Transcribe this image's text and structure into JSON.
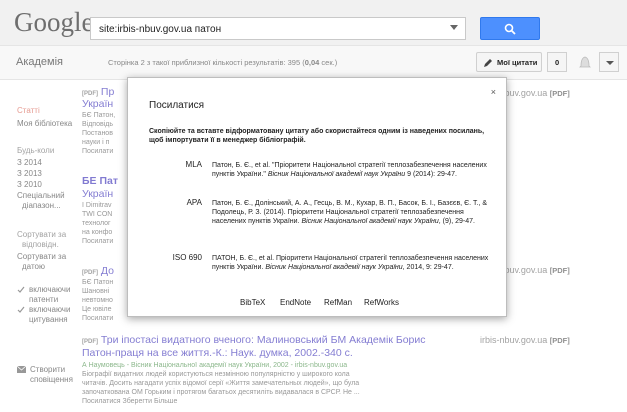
{
  "header": {
    "logo": "Google",
    "search_value": "site:irbis-nbuv.gov.ua патон",
    "search_icon": "search-icon"
  },
  "subheader": {
    "academy": "Академія",
    "result_stats_prefix": "Сторінка 2 з такої приблизної кількості результатів: 395 (",
    "result_stats_time": "0,04",
    "result_stats_suffix": " сек.)",
    "my_quotes": "Мої цитати",
    "count": "0"
  },
  "sidebar": {
    "items": [
      "Статті",
      "Моя бібліотека"
    ],
    "time_label": "Будь-коли",
    "years": [
      "З 2014",
      "З 2013",
      "З 2010"
    ],
    "custom_range": [
      "Спеціальний",
      "діапазон..."
    ],
    "sort_relevance": [
      "Сортувати за",
      "відповідн."
    ],
    "sort_date": [
      "Сортувати за",
      "датою"
    ],
    "include_patents": [
      "включаючи",
      "патенти"
    ],
    "include_citations": [
      "включаючи",
      "цитування"
    ],
    "create_alert": [
      "Створити",
      "сповіщення"
    ]
  },
  "results": [
    {
      "pdf": "[PDF]",
      "title_partial": "Пр",
      "line2": "Україн",
      "snippet": [
        "БЄ Патон,",
        "Відповідь",
        "Постанов",
        "науки і п",
        "Посилати"
      ]
    },
    {
      "title_partial": "БЕ Пат",
      "line2": "Україн",
      "snippet": [
        "I Dimitrav",
        "TWI CON",
        "технолог",
        "на конфо",
        "Посилати"
      ]
    },
    {
      "pdf": "[PDF]",
      "title_partial": "До",
      "snippet": [
        "БЄ Патон",
        "Шановні",
        "невтомно",
        "Це ювіле",
        "Посилати"
      ]
    },
    {
      "pdf": "[PDF]",
      "title": "Три іпостасі видатного вченого: Малиновський БМ Академік Борис",
      "title2": "Патон-праця на все життя.-К.: Наук. думка, 2002.-340 с.",
      "authors": "А Наумовець - Вісник Національної академії наук України, 2002 - irbis-nbuv.gov.ua",
      "snippet": [
        "Біографії видатних людей користуються незмінною популярністю у широкого кола",
        "читачів. Досить нагадати успіх відомої серії «Життя замечательных людей», що була",
        "започаткована ОМ Горьким і протягом багатьох десятиліть видавалася в СРСР. Не ..."
      ],
      "actions": "Посилатися   Зберегти   Більше"
    }
  ],
  "side_links": [
    "irbis-nbuv.gov.ua",
    "irbis-nbuv.gov.ua",
    "irbis-nbuv.gov.ua"
  ],
  "side_pdf": "[PDF]",
  "modal": {
    "title": "Посилатися",
    "close": "×",
    "description": "Скопіюйте та вставте відформатовану цитату або скористайтеся одним із наведених посилань, щоб імпортувати її в менеджер бібліографій.",
    "citations": [
      {
        "style": "MLA",
        "text_plain": "Патон, Б. Є., et al. \"Пріоритети Національної стратегії теплозабезпечення населених пунктів України.\" ",
        "text_italic": "Вісник Національної академії наук України",
        "text_end": " 9 (2014): 29-47."
      },
      {
        "style": "APA",
        "text_plain": "Патон, Б. Є., Долінський, А. А., Гесць, В. М., Кухар, В. П., Басок, Б. І., Базєєв, Є. Т., & Подолець, Р. З. (2014). Пріоритети Національної стратегії теплозабезпечення населених пунктів України. ",
        "text_italic": "Вісник Національної академії наук України",
        "text_end": ", (9), 29-47."
      },
      {
        "style": "ISO 690",
        "text_plain": "ПАТОН, Б. Є., et al. Пріоритети Національної стратегії теплозабезпечення населених пунктів України. ",
        "text_italic": "Вісник Національної академії наук України",
        "text_end": ", 2014, 9: 29-47."
      }
    ],
    "exports": [
      "BibTeX",
      "EndNote",
      "RefMan",
      "RefWorks"
    ]
  }
}
